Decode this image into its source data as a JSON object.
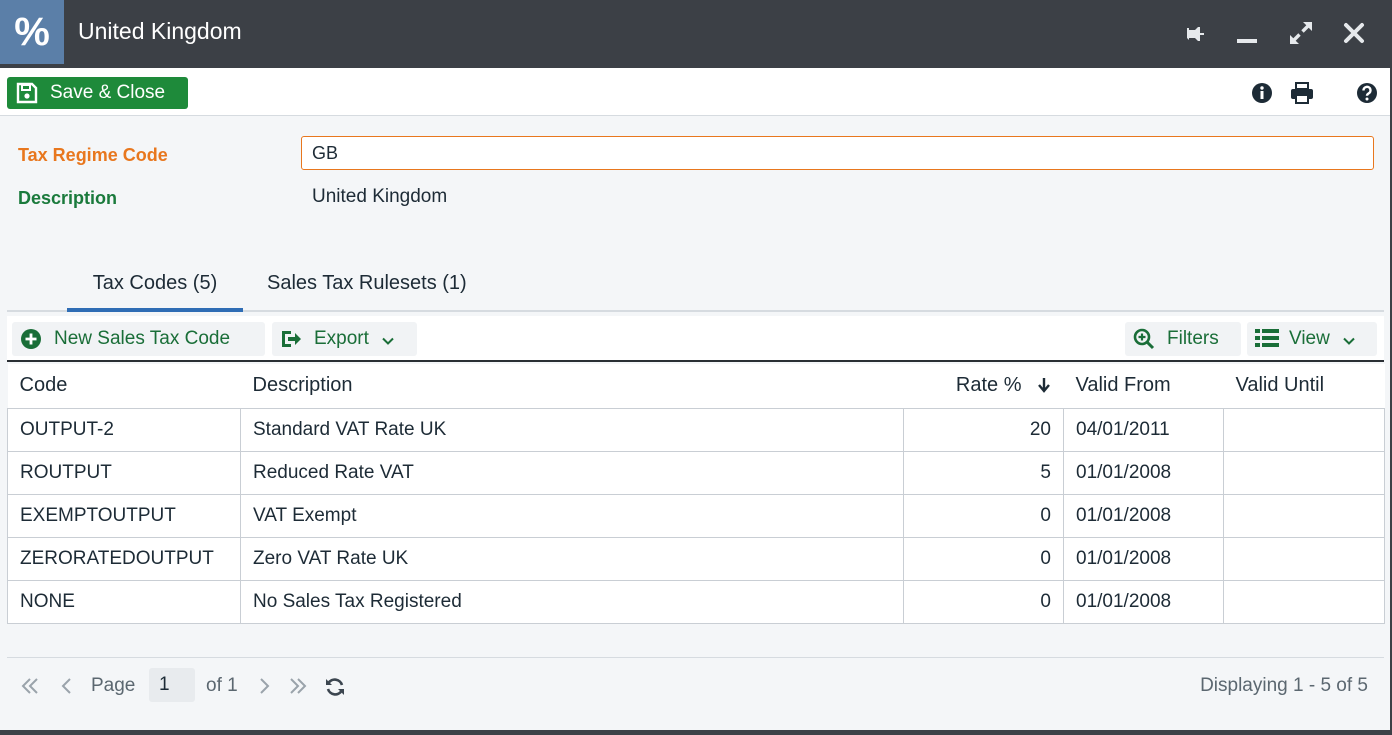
{
  "window": {
    "icon_glyph": "%",
    "title": "United Kingdom"
  },
  "toolbar": {
    "save_label": "Save & Close"
  },
  "form": {
    "code_label": "Tax Regime Code",
    "code_value": "GB",
    "description_label": "Description",
    "description_value": "United Kingdom"
  },
  "tabs": [
    {
      "label": "Tax Codes (5)",
      "active": true
    },
    {
      "label": "Sales Tax Rulesets (1)",
      "active": false
    }
  ],
  "grid_toolbar": {
    "new_label": "New Sales Tax Code",
    "export_label": "Export",
    "filters_label": "Filters",
    "view_label": "View"
  },
  "table": {
    "columns": [
      "Code",
      "Description",
      "Rate %",
      "Valid From",
      "Valid Until"
    ],
    "rows": [
      {
        "code": "OUTPUT-2",
        "description": "Standard VAT Rate UK",
        "rate": "20",
        "valid_from": "04/01/2011",
        "valid_until": ""
      },
      {
        "code": "ROUTPUT",
        "description": "Reduced Rate VAT",
        "rate": "5",
        "valid_from": "01/01/2008",
        "valid_until": ""
      },
      {
        "code": "EXEMPTOUTPUT",
        "description": "VAT Exempt",
        "rate": "0",
        "valid_from": "01/01/2008",
        "valid_until": ""
      },
      {
        "code": "ZERORATEDOUTPUT",
        "description": "Zero VAT Rate UK",
        "rate": "0",
        "valid_from": "01/01/2008",
        "valid_until": ""
      },
      {
        "code": "NONE",
        "description": "No Sales Tax Registered",
        "rate": "0",
        "valid_from": "01/01/2008",
        "valid_until": ""
      }
    ]
  },
  "pager": {
    "page_label": "Page",
    "page_value": "1",
    "of_label": "of 1",
    "displaying": "Displaying 1 - 5 of 5"
  },
  "colors": {
    "title_bar": "#3c4046",
    "app_icon_bg": "#5b7fa8",
    "save_button": "#1e8a3a",
    "required_label": "#e8771e",
    "label_green": "#1a7a3c",
    "active_tab": "#2f6db5"
  }
}
